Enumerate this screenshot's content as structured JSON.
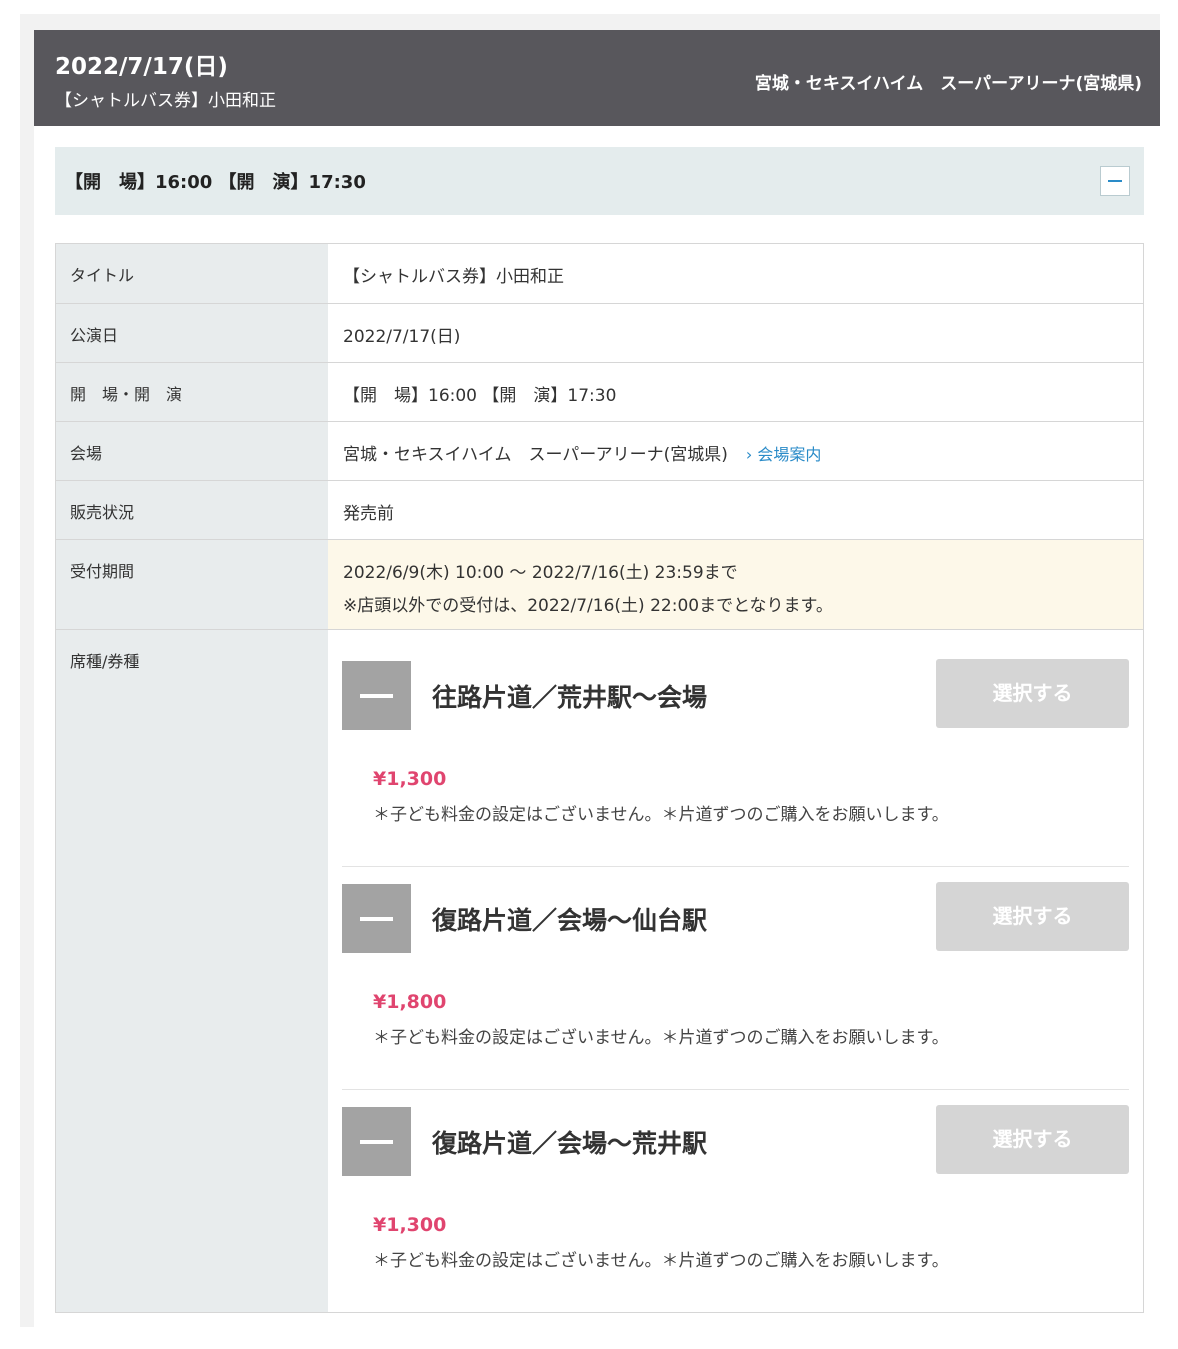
{
  "header": {
    "date": "2022/7/17(日)",
    "subtitle": "【シャトルバス券】小田和正",
    "venue": "宮城・セキスイハイム　スーパーアリーナ(宮城県)"
  },
  "time_bar": {
    "text": "【開　場】16:00 【開　演】17:30"
  },
  "details": {
    "title_label": "タイトル",
    "title_value": "【シャトルバス券】小田和正",
    "date_label": "公演日",
    "date_value": "2022/7/17(日)",
    "time_label": "開　場・開　演",
    "time_value": "【開　場】16:00 【開　演】17:30",
    "venue_label": "会場",
    "venue_value": "宮城・セキスイハイム　スーパーアリーナ(宮城県)",
    "venue_link": "› 会場案内",
    "status_label": "販売状況",
    "status_value": "発売前",
    "period_label": "受付期間",
    "period_value": "2022/6/9(木) 10:00 ～ 2022/7/16(土) 23:59まで",
    "period_notice": "※店頭以外での受付は、2022/7/16(土) 22:00までとなります。",
    "seat_label": "席種/券種"
  },
  "tickets": [
    {
      "name": "往路片道／荒井駅～会場",
      "price": "¥1,300",
      "note": "＊子ども料金の設定はございません。＊片道ずつのご購入をお願いします。",
      "button": "選択する"
    },
    {
      "name": "復路片道／会場～仙台駅",
      "price": "¥1,800",
      "note": "＊子ども料金の設定はございません。＊片道ずつのご購入をお願いします。",
      "button": "選択する"
    },
    {
      "name": "復路片道／会場～荒井駅",
      "price": "¥1,300",
      "note": "＊子ども料金の設定はございません。＊片道ずつのご購入をお願いします。",
      "button": "選択する"
    }
  ],
  "colors": {
    "header_bg": "#58575c",
    "label_bg": "#e8eced",
    "price": "#e0456f",
    "link": "#2a8bc8",
    "disabled_button": "#d5d5d5"
  }
}
